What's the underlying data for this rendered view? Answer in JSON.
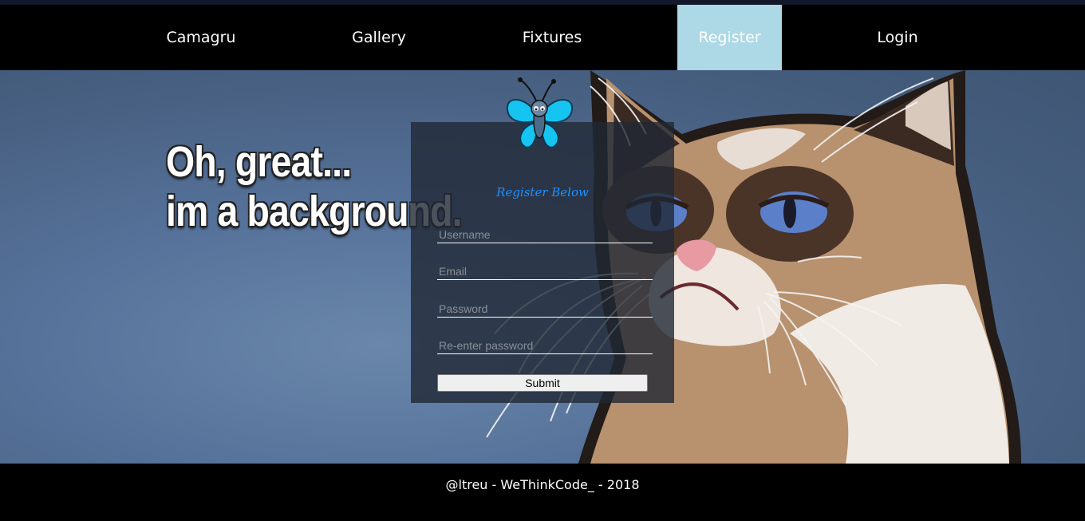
{
  "nav": {
    "items": [
      {
        "label": "Camagru"
      },
      {
        "label": "Gallery"
      },
      {
        "label": "Fixtures"
      },
      {
        "label": "Register",
        "active": true
      },
      {
        "label": "Login"
      }
    ],
    "active_color": "#add8e6"
  },
  "hero": {
    "meme_line1": "Oh, great...",
    "meme_line2": "im a background."
  },
  "form": {
    "title": "Register Below",
    "username_placeholder": "Username",
    "email_placeholder": "Email",
    "password_placeholder": "Password",
    "repassword_placeholder": "Re-enter password",
    "submit_label": "Submit",
    "title_color": "#1e90ff"
  },
  "footer": {
    "text": "@ltreu - WeThinkCode_ - 2018"
  }
}
